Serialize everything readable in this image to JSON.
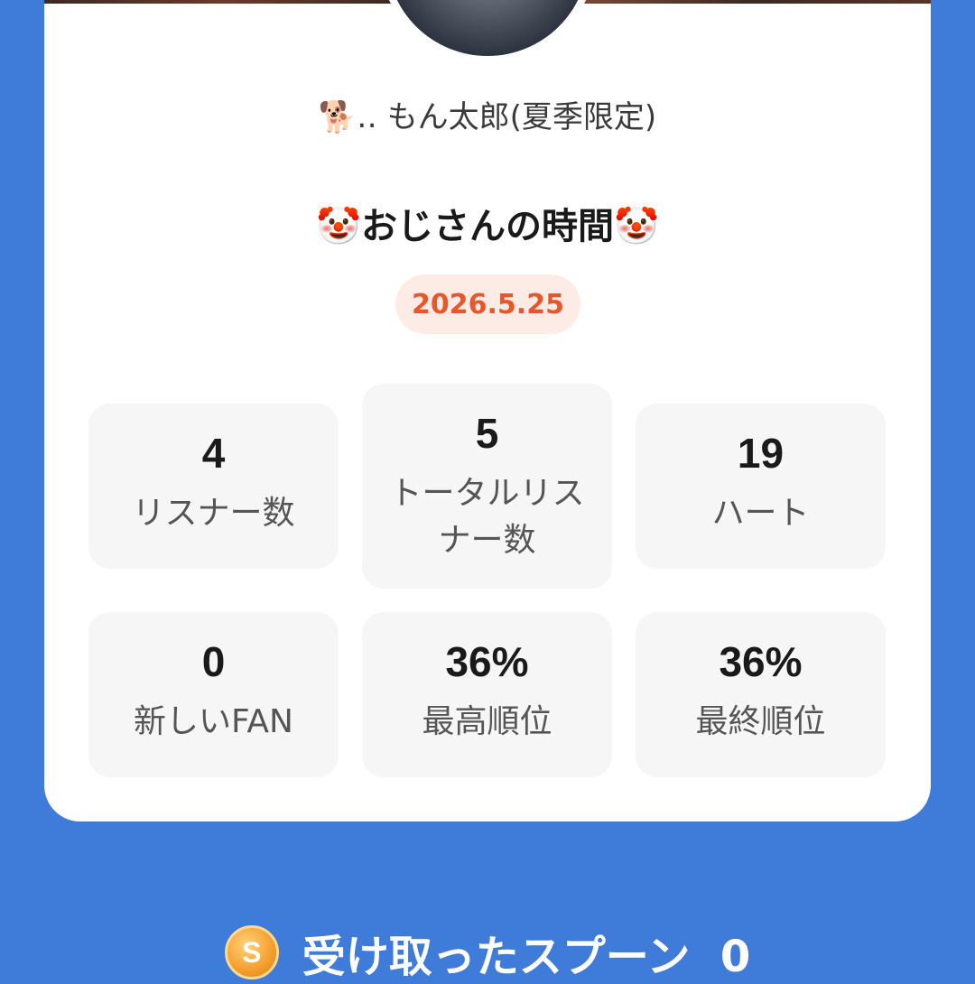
{
  "profile": {
    "username": "もん太郎(夏季限定)",
    "username_emoji": "🐕‥"
  },
  "live": {
    "title": "おじさんの時間",
    "title_emoji": "🤡",
    "date": "2026.5.25"
  },
  "stats": [
    {
      "value": "4",
      "label": "リスナー数"
    },
    {
      "value": "5",
      "label": "トータルリスナー数"
    },
    {
      "value": "19",
      "label": "ハート"
    },
    {
      "value": "0",
      "label": "新しいFAN"
    },
    {
      "value": "36%",
      "label": "最高順位"
    },
    {
      "value": "36%",
      "label": "最終順位"
    }
  ],
  "footer": {
    "coin_letter": "S",
    "label": "受け取ったスプーン",
    "count": "0"
  },
  "colors": {
    "background": "#3f7bd8",
    "card": "#ffffff",
    "date_text": "#e8572c",
    "date_pill": "#fdece6",
    "stat_box": "#f6f6f6"
  }
}
